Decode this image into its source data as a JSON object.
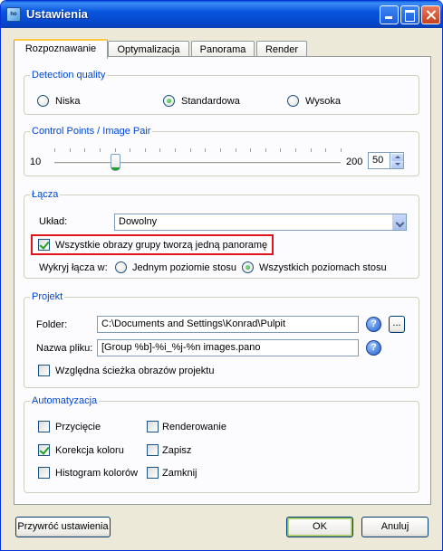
{
  "window": {
    "title": "Ustawienia",
    "icon_name": "app-icon",
    "icon_text": "ho"
  },
  "tabs": [
    {
      "label": "Rozpoznawanie",
      "active": true
    },
    {
      "label": "Optymalizacja",
      "active": false
    },
    {
      "label": "Panorama",
      "active": false
    },
    {
      "label": "Render",
      "active": false
    }
  ],
  "detection": {
    "title": "Detection quality",
    "options": [
      {
        "label": "Niska",
        "checked": false
      },
      {
        "label": "Standardowa",
        "checked": true
      },
      {
        "label": "Wysoka",
        "checked": false
      }
    ]
  },
  "control_points": {
    "title": "Control Points / Image Pair",
    "min_label": "10",
    "max_label": "200",
    "value": "50",
    "min": 10,
    "max": 200,
    "current": 50
  },
  "links": {
    "title": "Łącza",
    "layout_label": "Układ:",
    "layout_value": "Dowolny",
    "all_images_label": "Wszystkie obrazy grupy tworzą jedną panoramę",
    "all_images_checked": true,
    "detect_label": "Wykryj łącza w:",
    "detect_options": [
      {
        "label": "Jednym poziomie stosu",
        "checked": false
      },
      {
        "label": "Wszystkich poziomach stosu",
        "checked": true
      }
    ]
  },
  "project": {
    "title": "Projekt",
    "folder_label": "Folder:",
    "folder_value": "C:\\Documents and Settings\\Konrad\\Pulpit",
    "filename_label": "Nazwa pliku:",
    "filename_value": "[Group %b]-%i_%j-%n images.pano",
    "relative_label": "Względna ścieżka obrazów projektu",
    "relative_checked": false,
    "browse_label": "...",
    "help_label": "?"
  },
  "automation": {
    "title": "Automatyzacja",
    "left": [
      {
        "label": "Przycięcie",
        "checked": false
      },
      {
        "label": "Korekcja koloru",
        "checked": true
      },
      {
        "label": "Histogram kolorów",
        "checked": false
      }
    ],
    "right": [
      {
        "label": "Renderowanie",
        "checked": false
      },
      {
        "label": "Zapisz",
        "checked": false
      },
      {
        "label": "Zamknij",
        "checked": false
      }
    ]
  },
  "buttons": {
    "restore": "Przywróć ustawienia",
    "ok": "OK",
    "cancel": "Anuluj"
  },
  "colors": {
    "group_title": "#0046d5",
    "highlight": "#e0141a",
    "titlebar": "#0855dd"
  }
}
